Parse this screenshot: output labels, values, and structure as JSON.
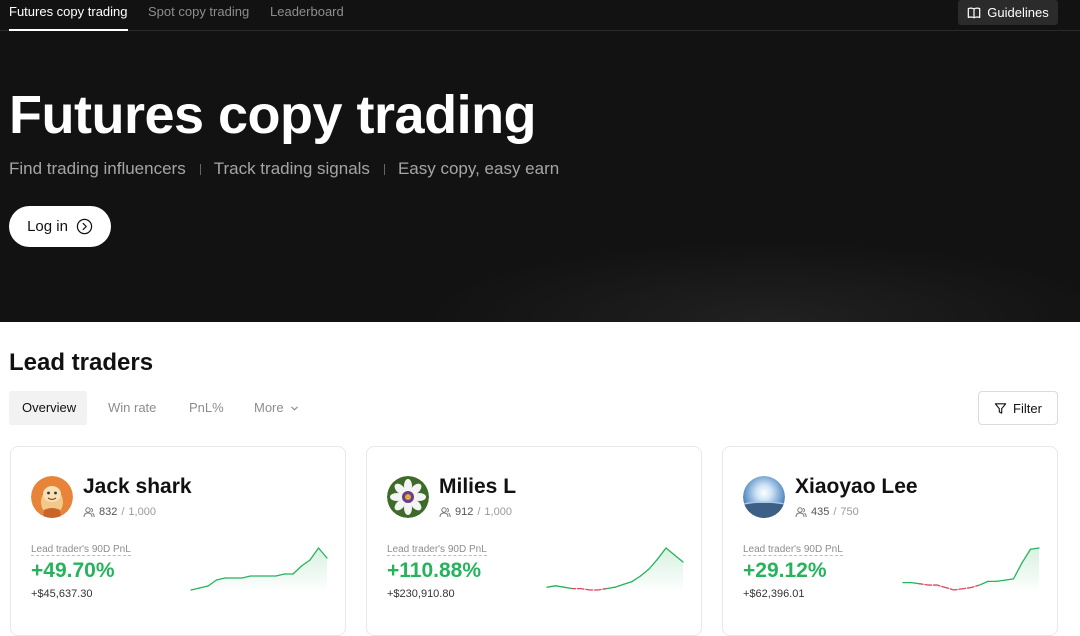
{
  "nav": {
    "tabs": [
      {
        "label": "Futures copy trading",
        "active": true
      },
      {
        "label": "Spot copy trading",
        "active": false
      },
      {
        "label": "Leaderboard",
        "active": false
      }
    ],
    "guidelines_label": "Guidelines",
    "guidelines_icon": "book-icon"
  },
  "hero": {
    "title": "Futures copy trading",
    "subtitles": [
      "Find trading influencers",
      "Track trading signals",
      "Easy copy, easy earn"
    ],
    "login_label": "Log in",
    "login_icon": "chevron-circle-right-icon"
  },
  "lead_traders": {
    "title": "Lead traders",
    "tabs": [
      {
        "label": "Overview",
        "active": true
      },
      {
        "label": "Win rate",
        "active": false
      },
      {
        "label": "PnL%",
        "active": false
      },
      {
        "label": "More",
        "active": false
      }
    ],
    "filter_label": "Filter",
    "filter_icon": "funnel-icon"
  },
  "colors": {
    "positive": "#26b35c",
    "negative": "#e0425f",
    "hero_bg": "#121212"
  },
  "traders": [
    {
      "name": "Jack shark",
      "followers": "832",
      "max_followers": "1,000",
      "pnl_label": "Lead trader's 90D PnL",
      "pnl_pct": "+49.70%",
      "pnl_abs": "+$45,637.30",
      "avatar": "cartoon-avatar",
      "spark": [
        4,
        5,
        6,
        9,
        10,
        10,
        10,
        11,
        11,
        11,
        11,
        12,
        12,
        16,
        19,
        25,
        20
      ]
    },
    {
      "name": "Milies L",
      "followers": "912",
      "max_followers": "1,000",
      "pnl_label": "Lead trader's 90D PnL",
      "pnl_pct": "+110.88%",
      "pnl_abs": "+$230,910.80",
      "avatar": "flower-avatar",
      "spark": [
        4,
        5,
        4,
        3,
        3,
        2,
        2,
        3,
        4,
        6,
        8,
        12,
        17,
        24,
        32,
        27,
        22
      ]
    },
    {
      "name": "Xiaoyao Lee",
      "followers": "435",
      "max_followers": "750",
      "pnl_label": "Lead trader's 90D PnL",
      "pnl_pct": "+29.12%",
      "pnl_abs": "+$62,396.01",
      "avatar": "sky-avatar",
      "spark": [
        6,
        6,
        5,
        4,
        4,
        2,
        0,
        1,
        2,
        4,
        7,
        7,
        8,
        9,
        22,
        33,
        34
      ]
    }
  ]
}
